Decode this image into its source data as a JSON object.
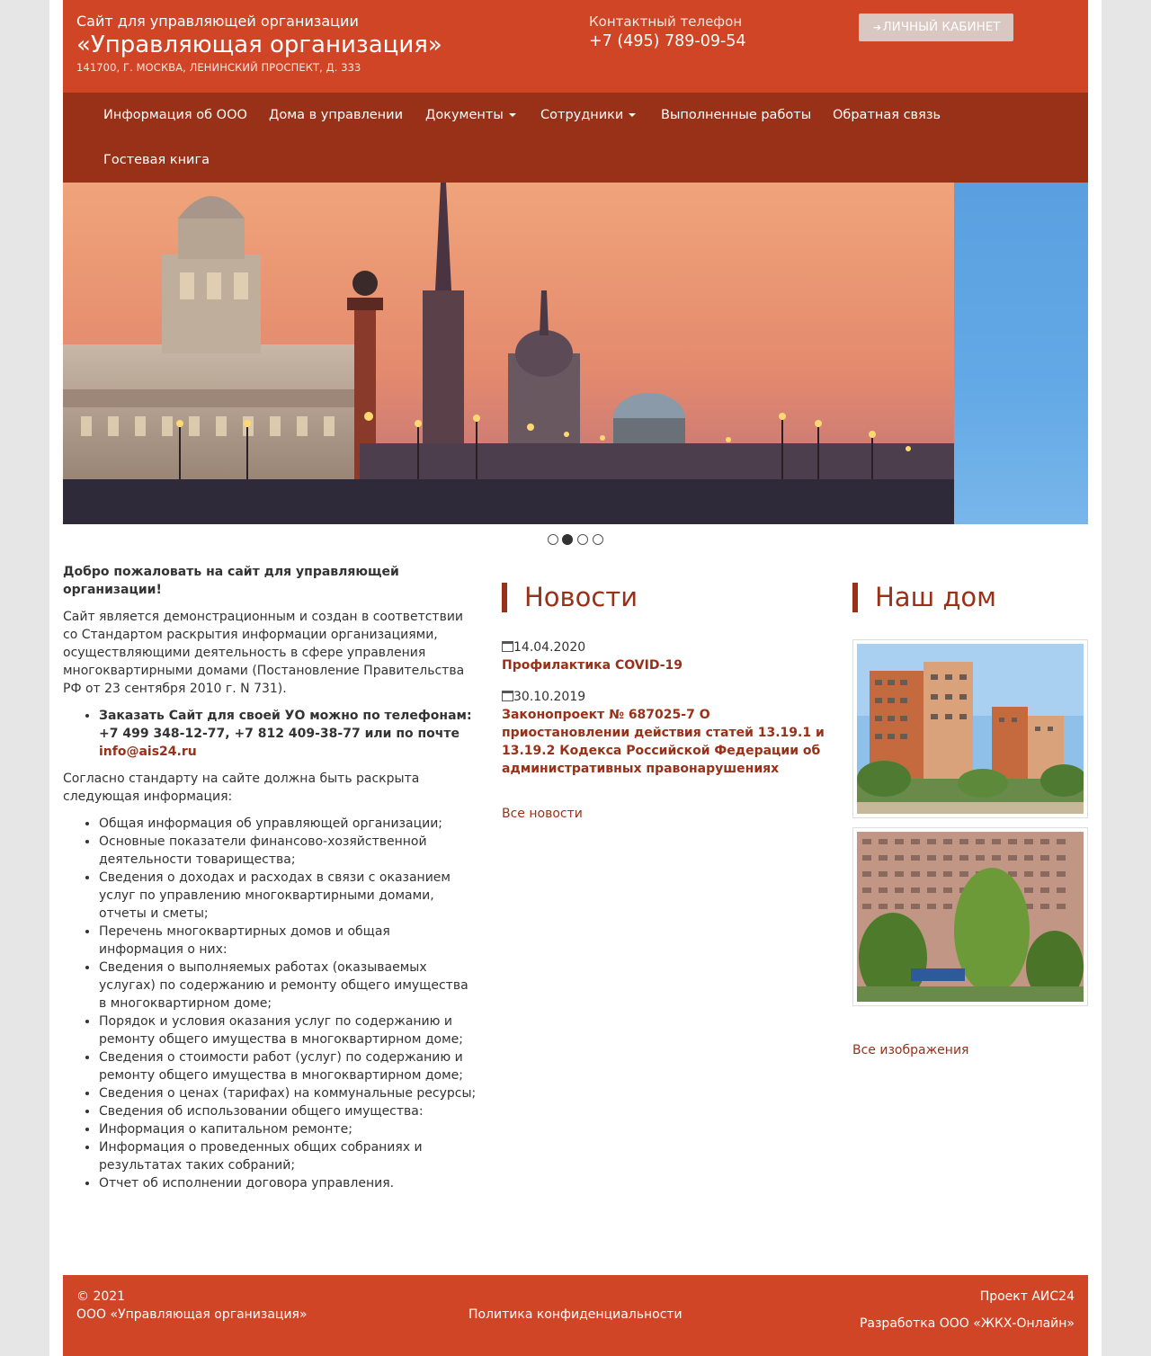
{
  "header": {
    "subtitle": "Сайт для управляющей организации",
    "title": "«Управляющая организация»",
    "address": "141700, Г. МОСКВА, ЛЕНИНСКИЙ ПРОСПЕКТ, Д. 333",
    "phone_label": "Контактный телефон",
    "phone": "+7 (495) 789-09-54",
    "cabinet_button": "ЛИЧНЫЙ КАБИНЕТ"
  },
  "nav": {
    "items": [
      {
        "label": "Информация об ООО",
        "dropdown": false
      },
      {
        "label": "Дома в управлении",
        "dropdown": false
      },
      {
        "label": "Документы",
        "dropdown": true
      },
      {
        "label": "Сотрудники",
        "dropdown": true
      },
      {
        "label": "Выполненные работы",
        "dropdown": false
      },
      {
        "label": "Обратная связь",
        "dropdown": false
      },
      {
        "label": "Гостевая книга",
        "dropdown": false
      }
    ]
  },
  "slider": {
    "slide_count": 4,
    "active_slide": 2
  },
  "intro": {
    "welcome": "Добро пожаловать на сайт для управляющей организации!",
    "paragraph": "Сайт является демонстрационным и создан в соответствии со Стандартом раскрытия информации организациями, осуществляющими деятельность в сфере управления многоквартирными домами (Постановление Правительства РФ от 23 сентября 2010 г. N 731).",
    "order_text": "Заказать Сайт для своей УО можно по телефонам: +7 499 348-12-77, +7 812 409-38-77 или по почте ",
    "order_email": "info@ais24.ru",
    "standard_text": "Согласно стандарту на сайте должна быть раскрыта следующая информация:",
    "items": [
      "Общая информация об управляющей организации;",
      "Основные показатели финансово-хозяйственной деятельности товарищества;",
      "Сведения о доходах и расходах в связи с оказанием услуг по управлению многоквартирными домами, отчеты и сметы;",
      "Перечень многоквартирных домов и общая информация о них:",
      "Сведения о выполняемых работах (оказываемых услугах) по содержанию и ремонту общего имущества в многоквартирном доме;",
      "Порядок и условия оказания услуг по содержанию и ремонту общего имущества в многоквартирном доме;",
      "Сведения о стоимости работ (услуг) по содержанию и ремонту общего имущества в многоквартирном доме;",
      "Сведения о ценах (тарифах) на коммунальные ресурсы;",
      "Сведения об использовании общего имущества:",
      "Информация о капитальном ремонте;",
      "Информация о проведенных общих собраниях и результатах таких собраний;",
      "Отчет об исполнении договора управления."
    ]
  },
  "news": {
    "title": "Новости",
    "items": [
      {
        "date": "14.04.2020",
        "title": "Профилактика COVID-19"
      },
      {
        "date": "30.10.2019",
        "title": "Законопроект № 687025-7 О приостановлении действия статей 13.19.1 и 13.19.2 Кодекса Российской Федерации об административных правонарушениях"
      }
    ],
    "all_link": "Все новости"
  },
  "gallery": {
    "title": "Наш дом",
    "all_link": "Все изображения"
  },
  "footer": {
    "copyright": "© 2021",
    "company": "ООО «Управляющая организация»",
    "privacy": "Политика конфиденциальности",
    "project": "Проект АИС24",
    "developer": "Разработка ООО «ЖКХ-Онлайн»"
  },
  "colors": {
    "brand": "#cf4526",
    "nav": "#993018",
    "accent_text": "#993018"
  }
}
